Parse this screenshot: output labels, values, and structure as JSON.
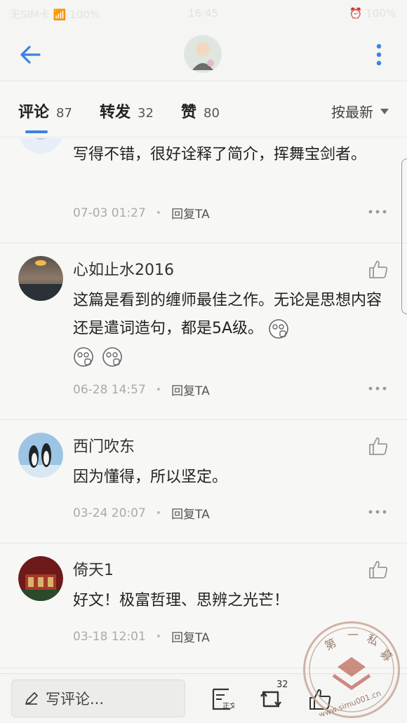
{
  "status_bar": {
    "left": "无SIM卡 📶 100%",
    "time": "16:45",
    "right": "⏰ 100%"
  },
  "header": {
    "back_icon": "back-arrow-icon",
    "more_icon": "more-vertical-icon"
  },
  "tabs": {
    "comments": {
      "label": "评论",
      "count": "87"
    },
    "reposts": {
      "label": "转发",
      "count": "32"
    },
    "likes": {
      "label": "赞",
      "count": "80"
    },
    "sort_label": "按最新"
  },
  "comments": [
    {
      "name": "",
      "text": "写得不错，很好诠释了简介，挥舞宝剑者。",
      "time": "07-03 01:27",
      "reply": "回复TA"
    },
    {
      "name": "心如止水2016",
      "text": "这篇是看到的缠师最佳之作。无论是思想内容还是遣词造句，都是5A级。",
      "time": "06-28 14:57",
      "reply": "回复TA"
    },
    {
      "name": "西门吹东",
      "text": "因为懂得，所以坚定。",
      "time": "03-24 20:07",
      "reply": "回复TA"
    },
    {
      "name": "倚天1",
      "text": "好文！极富哲理、思辨之光芒！",
      "time": "03-18 12:01",
      "reply": "回复TA"
    }
  ],
  "bottom_bar": {
    "write_label": "写评论...",
    "repost_count": "32"
  },
  "watermark": {
    "text": "第一私募",
    "url": "www.simu001.cn"
  },
  "colors": {
    "accent": "#3b82e0",
    "background": "#f7f7f5"
  }
}
